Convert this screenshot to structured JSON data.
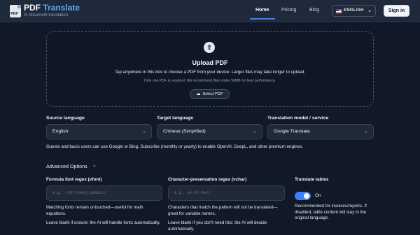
{
  "header": {
    "logo_text": "PDF",
    "brand_main": "PDF ",
    "brand_accent": "Translate",
    "tagline": "AI document translation",
    "nav": [
      {
        "label": "Home"
      },
      {
        "label": "Pricing"
      },
      {
        "label": "Blog"
      }
    ],
    "language": "ENGLISH",
    "signin_label": "Sign in"
  },
  "upload": {
    "title": "Upload PDF",
    "description": "Tap anywhere in this box to choose a PDF from your device. Larger files may take longer to upload.",
    "note": "Only one PDF is required. We recommend files under 50MB for best performance.",
    "button_label": "Select PDF"
  },
  "settings": {
    "source": {
      "label": "Source language",
      "value": "English"
    },
    "target": {
      "label": "Target language",
      "value": "Chinese (Simplified)"
    },
    "model": {
      "label": "Translation model / service",
      "value": "Google Translate"
    },
    "guest_note": "Guests and basic users can use Google or Bing. Subscribe (monthly or yearly) to enable OpenAI, DeepL, and other premium engines."
  },
  "advanced": {
    "title": "Advanced Options",
    "font_regex": {
      "label": "Formula font regex (vfont)",
      "placeholder": "e.g. (cmr|cmsy|Symbol)",
      "hint1": "Matching fonts remain untouched—useful for math equations.",
      "hint2": "Leave blank if unsure; the AI will handle fonts automatically."
    },
    "char_regex": {
      "label": "Character-preservation regex (vchar)",
      "placeholder": "e.g. [A-Z0-9±+]",
      "hint1": "Characters that match the pattern will not be translated—great for variable names.",
      "hint2": "Leave blank if you don't need this; the AI will decide automatically."
    },
    "tables": {
      "label": "Translate tables",
      "state": "On",
      "hint": "Recommended for invoices/reports. If disabled, table content will stay in the original language."
    }
  },
  "colors": {
    "background": "#111827",
    "header": "#1e293b",
    "accent": "#3b82f6",
    "brand_accent": "#60a5fa"
  }
}
